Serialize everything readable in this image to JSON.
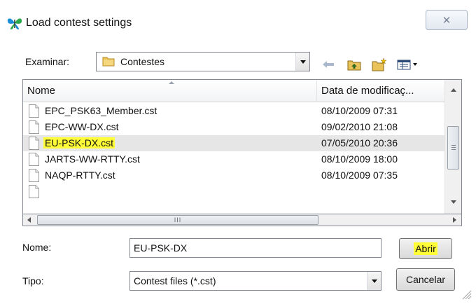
{
  "window": {
    "title": "Load contest settings",
    "close_glyph": "✕"
  },
  "lookin": {
    "label": "Examinar:",
    "folder": "Contestes"
  },
  "list": {
    "columns": [
      "Nome",
      "Data de modificaç..."
    ],
    "rows": [
      {
        "name": "EPC_PSK63_Member.cst",
        "date": "08/10/2009 07:31"
      },
      {
        "name": "EPC-WW-DX.cst",
        "date": "09/02/2010 21:08"
      },
      {
        "name": "EU-PSK-DX.cst",
        "date": "07/05/2010 20:36"
      },
      {
        "name": "JARTS-WW-RTTY.cst",
        "date": "08/10/2009 18:00"
      },
      {
        "name": "NAQP-RTTY.cst",
        "date": "08/10/2009 07:35"
      }
    ],
    "selected_index": 2,
    "hscroll_grip": "III"
  },
  "filename": {
    "label": "Nome:",
    "value": "EU-PSK-DX"
  },
  "filetype": {
    "label": "Tipo:",
    "value": "Contest files (*.cst)"
  },
  "buttons": {
    "open": "Abrir",
    "cancel": "Cancelar"
  },
  "colors": {
    "highlight": "#fffc38",
    "selected_row": "#e6e6e6",
    "back_arrow": "#a9b8cc"
  },
  "icons": [
    "butterfly-app-icon",
    "folder-icon",
    "back-arrow-icon",
    "up-folder-icon",
    "new-folder-icon",
    "view-menu-icon",
    "file-icon"
  ]
}
